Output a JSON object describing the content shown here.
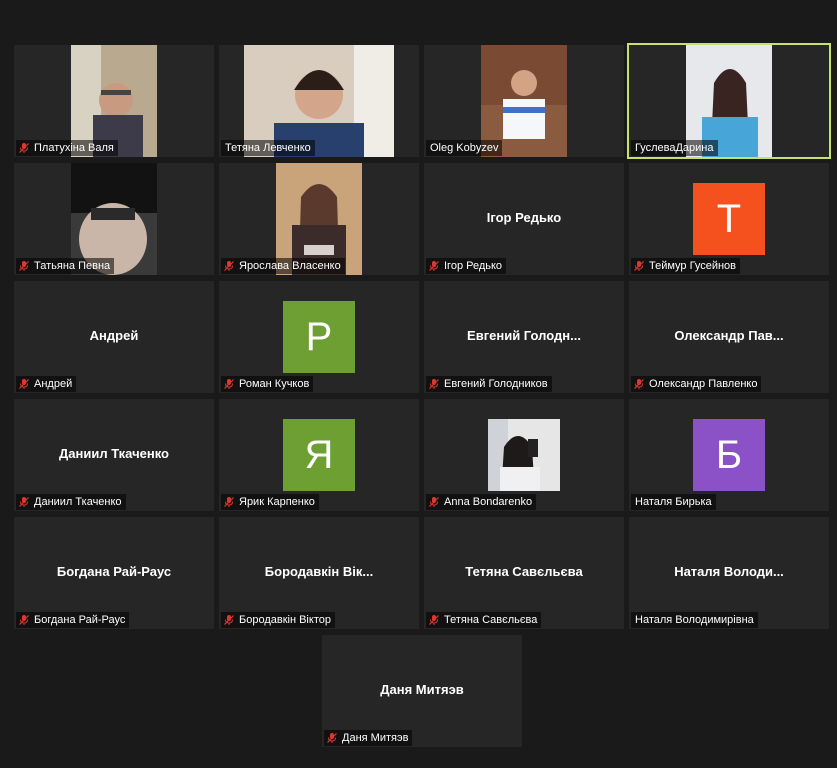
{
  "colors": {
    "active_speaker": "#c5e26e",
    "muted_icon": "#e0362f",
    "tile_bg": "#262626",
    "avatar_T": "#f4511e",
    "avatar_P": "#6e9f33",
    "avatar_Ya": "#6e9f33",
    "avatar_B": "#8a52c6"
  },
  "participants": [
    {
      "name": "Платухіна Валя",
      "muted": true,
      "display": "video"
    },
    {
      "name": "Тетяна Левченко",
      "muted": false,
      "display": "video"
    },
    {
      "name": "Oleg Kobyzev",
      "muted": false,
      "display": "video"
    },
    {
      "name": "ГуслеваДарина",
      "muted": false,
      "display": "video",
      "active": true
    },
    {
      "name": "Татьяна Певна",
      "muted": true,
      "display": "video"
    },
    {
      "name": "Ярослава Власенко",
      "muted": true,
      "display": "video"
    },
    {
      "name": "Ігор Редько",
      "center_label": "Ігор Редько",
      "muted": true,
      "display": "name"
    },
    {
      "name": "Теймур Гусейнов",
      "avatar_letter": "T",
      "muted": true,
      "display": "avatar"
    },
    {
      "name": "Андрей",
      "center_label": "Андрей",
      "muted": true,
      "display": "name"
    },
    {
      "name": "Роман Кучков",
      "avatar_letter": "P",
      "muted": true,
      "display": "avatar"
    },
    {
      "name": "Евгений Голодников",
      "center_label": "Евгений  Голодн...",
      "muted": true,
      "display": "name"
    },
    {
      "name": "Олександр Павленко",
      "center_label": "Олександр  Пав...",
      "muted": true,
      "display": "name"
    },
    {
      "name": "Даниил Ткаченко",
      "center_label": "Даниил Ткаченко",
      "muted": true,
      "display": "name"
    },
    {
      "name": "Ярик Карпенко",
      "avatar_letter": "Я",
      "muted": true,
      "display": "avatar"
    },
    {
      "name": "Anna Bondarenko",
      "muted": true,
      "display": "video"
    },
    {
      "name": "Наталя Бирька",
      "avatar_letter": "Б",
      "muted": false,
      "display": "avatar"
    },
    {
      "name": "Богдана Рай-Раус",
      "center_label": "Богдана Рай-Раус",
      "muted": true,
      "display": "name"
    },
    {
      "name": "Бородавкін Віктор",
      "center_label": "Бородавкін  Вік...",
      "muted": true,
      "display": "name"
    },
    {
      "name": "Тетяна Савєльєва",
      "center_label": "Тетяна Савєльєва",
      "muted": true,
      "display": "name"
    },
    {
      "name": "Наталя Володимирівна",
      "center_label": "Наталя  Володи...",
      "muted": false,
      "display": "name"
    },
    {
      "name": "Даня Митяэв",
      "center_label": "Даня Митяэв",
      "muted": true,
      "display": "name"
    }
  ]
}
